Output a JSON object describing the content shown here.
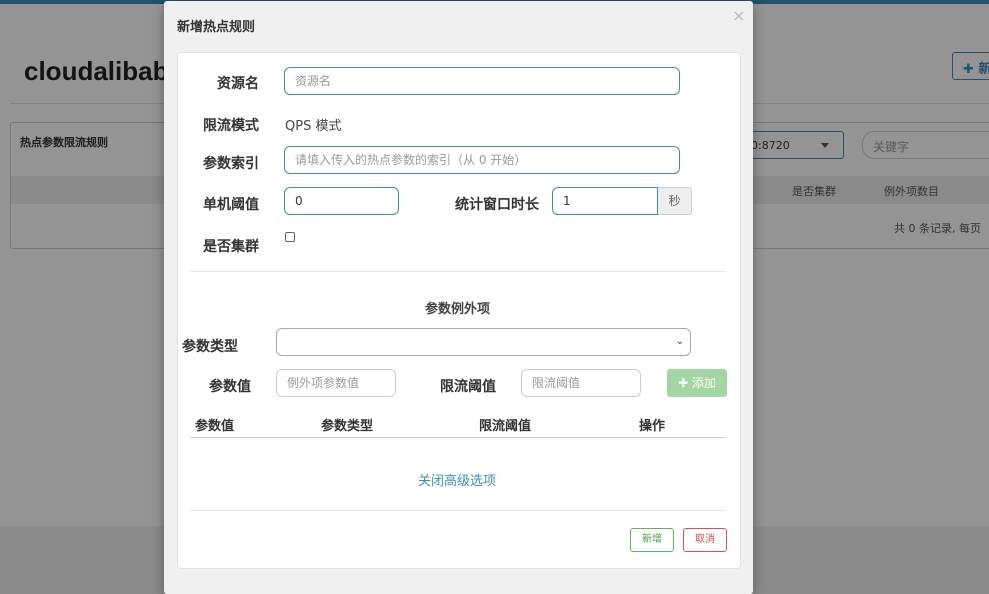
{
  "background": {
    "page_title": "cloudalibab",
    "new_button_label": "✚ 新",
    "panel_title": "热点参数限流规则",
    "machine_select_value": "0:8720",
    "search_placeholder": "关键字",
    "table_headers": [
      "是否集群",
      "例外项数目"
    ],
    "total_text": "共 0 条记录, 每页"
  },
  "modal": {
    "title": "新增热点规则",
    "close_label": "×",
    "fields": {
      "resource_label": "资源名",
      "resource_placeholder": "资源名",
      "mode_label": "限流模式",
      "mode_value": "QPS 模式",
      "param_index_label": "参数索引",
      "param_index_placeholder": "请填入传入的热点参数的索引（从 0 开始）",
      "threshold_label": "单机阈值",
      "threshold_value": "0",
      "window_label": "统计窗口时长",
      "window_value": "1",
      "window_unit": "秒",
      "cluster_label": "是否集群"
    },
    "exception": {
      "section_title": "参数例外项",
      "param_type_label": "参数类型",
      "param_type_value": "",
      "param_value_label": "参数值",
      "param_value_placeholder": "例外项参数值",
      "limit_label": "限流阈值",
      "limit_placeholder": "限流阈值",
      "add_button_label": "✚ 添加",
      "table_headers": [
        "参数值",
        "参数类型",
        "限流阈值",
        "操作"
      ]
    },
    "advanced_toggle_label": "关闭高级选项",
    "footer": {
      "submit_label": "新增",
      "cancel_label": "取消"
    }
  }
}
